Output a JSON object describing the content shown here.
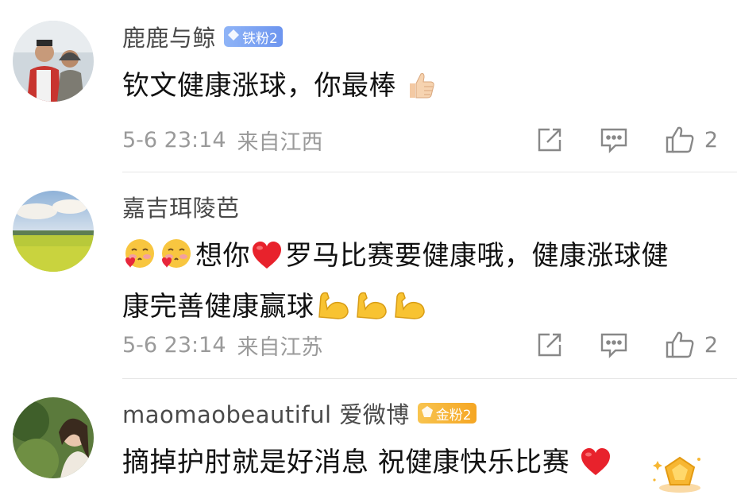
{
  "comments": [
    {
      "username": "鹿鹿与鲸",
      "badge": {
        "label": "铁粉2",
        "type": "iron"
      },
      "text": "钦文健康涨球，你最棒",
      "time": "5-6 23:14",
      "location": "来自江西",
      "likes": "2"
    },
    {
      "username": "嘉吉珥陵芭",
      "text_line1": "想你",
      "text_line1b": "罗马比赛要健康哦，健康涨球健",
      "text_line2": "康完善健康赢球",
      "time": "5-6 23:14",
      "location": "来自江苏",
      "likes": "2"
    },
    {
      "username": "maomaobeautiful 爱微博",
      "badge": {
        "label": "金粉2",
        "type": "gold"
      },
      "text": "摘掉护肘就是好消息 祝健康快乐比赛"
    }
  ],
  "icons": [
    "thumbs-up-emoji-icon",
    "kiss-heart-emoji-icon",
    "red-heart-icon",
    "flexed-biceps-icon",
    "share-icon",
    "comment-icon",
    "like-icon",
    "gold-badge-medal-icon"
  ],
  "colors": {
    "meta": "#9a9a9a",
    "iron_badge": "#7aa3f2",
    "gold_badge": "#f5b335"
  }
}
